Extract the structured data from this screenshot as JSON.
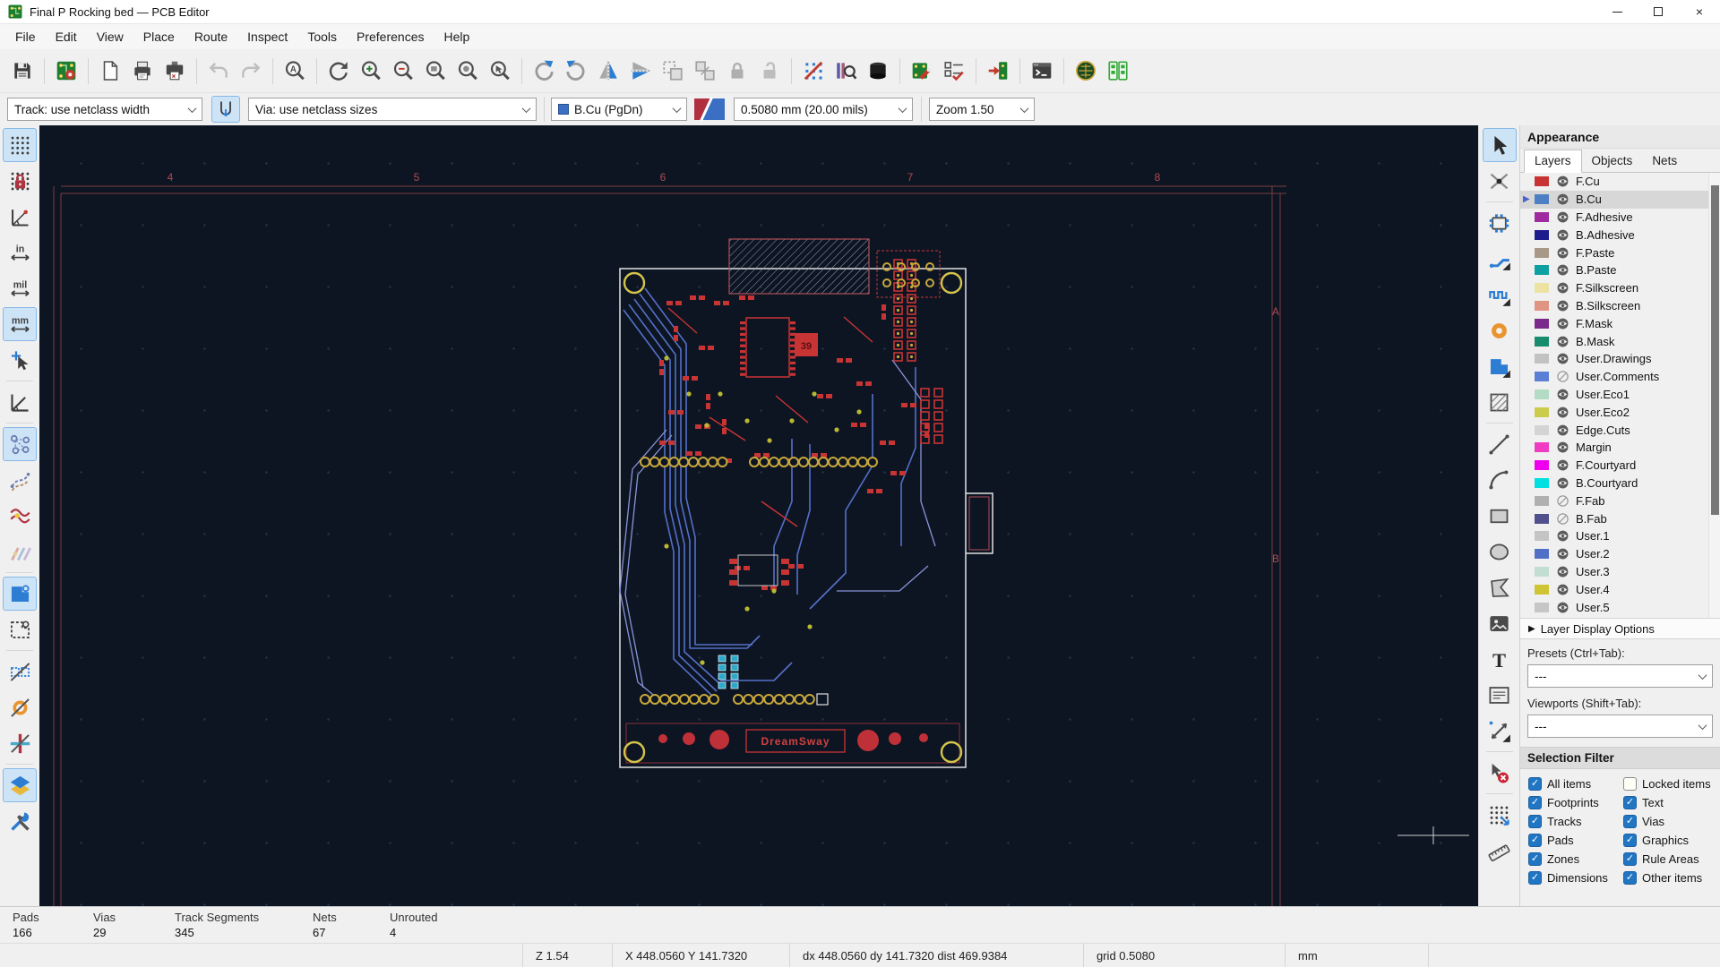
{
  "window": {
    "title": "Final P Rocking bed — PCB Editor"
  },
  "menu": {
    "items": [
      "File",
      "Edit",
      "View",
      "Place",
      "Route",
      "Inspect",
      "Tools",
      "Preferences",
      "Help"
    ]
  },
  "toolbar_top": {
    "buttons": [
      {
        "name": "save-icon"
      },
      {
        "sep": true
      },
      {
        "name": "board-setup-icon"
      },
      {
        "sep": true
      },
      {
        "name": "page-settings-icon"
      },
      {
        "name": "print-icon"
      },
      {
        "name": "plot-icon"
      },
      {
        "sep": true
      },
      {
        "name": "undo-icon",
        "disabled": true
      },
      {
        "name": "redo-icon",
        "disabled": true
      },
      {
        "sep": true
      },
      {
        "name": "find-icon"
      },
      {
        "sep": true
      },
      {
        "name": "refresh-icon"
      },
      {
        "name": "zoom-in-icon"
      },
      {
        "name": "zoom-out-icon"
      },
      {
        "name": "zoom-fit-icon"
      },
      {
        "name": "zoom-objects-icon"
      },
      {
        "name": "zoom-selection-icon"
      },
      {
        "sep": true
      },
      {
        "name": "rotate-ccw-icon"
      },
      {
        "name": "rotate-cw-icon"
      },
      {
        "name": "flip-horizontal-icon"
      },
      {
        "name": "flip-vertical-icon"
      },
      {
        "name": "group-icon",
        "disabled": true
      },
      {
        "name": "ungroup-icon",
        "disabled": true
      },
      {
        "name": "lock-icon",
        "disabled": true
      },
      {
        "name": "unlock-icon",
        "disabled": true
      },
      {
        "sep": true
      },
      {
        "name": "ratsnest-visibility-icon"
      },
      {
        "name": "net-inspector-icon"
      },
      {
        "name": "layer-stack-icon"
      },
      {
        "sep": true
      },
      {
        "name": "footprint-editor-icon"
      },
      {
        "name": "drc-icon"
      },
      {
        "sep": true
      },
      {
        "name": "update-pcb-icon"
      },
      {
        "sep": true
      },
      {
        "name": "scripting-console-icon"
      },
      {
        "sep": true
      },
      {
        "name": "3d-viewer-icon"
      },
      {
        "name": "board-statistics-icon"
      }
    ]
  },
  "toolbar_options": {
    "track_width": "Track: use netclass width",
    "via_size": "Via: use netclass sizes",
    "active_layer": "B.Cu (PgDn)",
    "grid": "0.5080 mm (20.00 mils)",
    "zoom": "Zoom 1.50",
    "layer_color": "#3a6fc4"
  },
  "toolbar_left": {
    "buttons": [
      {
        "name": "grid-visibility-icon",
        "active": true
      },
      {
        "name": "grid-override-icon"
      },
      {
        "name": "polar-coords-icon"
      },
      {
        "name": "units-inches-icon",
        "label": "in"
      },
      {
        "name": "units-mils-icon",
        "label": "mil"
      },
      {
        "name": "units-mm-icon",
        "label": "mm",
        "active": true
      },
      {
        "name": "cursor-shape-icon"
      },
      {
        "sep": true
      },
      {
        "name": "constrain-45-icon"
      },
      {
        "sep": true
      },
      {
        "name": "ratsnest-show-icon",
        "active": true
      },
      {
        "name": "ratsnest-curved-icon"
      },
      {
        "name": "net-highlight-icon"
      },
      {
        "name": "net-colors-icon"
      },
      {
        "sep": true
      },
      {
        "name": "zones-filled-icon",
        "active": true
      },
      {
        "name": "zones-outline-icon"
      },
      {
        "sep": true
      },
      {
        "name": "pads-outline-icon"
      },
      {
        "name": "vias-outline-icon"
      },
      {
        "name": "tracks-outline-icon"
      },
      {
        "sep": true
      },
      {
        "name": "high-contrast-icon",
        "active": true
      },
      {
        "name": "settings-tools-icon"
      }
    ]
  },
  "toolbar_right": {
    "buttons": [
      {
        "name": "select-icon",
        "active": true
      },
      {
        "name": "highlight-net-icon"
      },
      {
        "sep": true
      },
      {
        "name": "footprint-tool-icon"
      },
      {
        "name": "route-track-icon",
        "corner": true
      },
      {
        "name": "tune-length-icon",
        "corner": true
      },
      {
        "name": "via-tool-icon"
      },
      {
        "name": "zone-tool-icon"
      },
      {
        "name": "rule-area-icon"
      },
      {
        "sep": true
      },
      {
        "name": "line-tool-icon"
      },
      {
        "name": "arc-tool-icon"
      },
      {
        "name": "rect-tool-icon"
      },
      {
        "name": "circle-tool-icon"
      },
      {
        "name": "polygon-tool-icon"
      },
      {
        "name": "image-tool-icon"
      },
      {
        "name": "text-tool-icon"
      },
      {
        "name": "textbox-tool-icon"
      },
      {
        "name": "dimension-tool-icon",
        "corner": true
      },
      {
        "sep": true
      },
      {
        "name": "delete-tool-icon"
      },
      {
        "sep": true
      },
      {
        "name": "origin-tool-icon",
        "corner": true
      },
      {
        "name": "measure-tool-icon"
      }
    ]
  },
  "appearance": {
    "title": "Appearance",
    "tabs": [
      {
        "label": "Layers",
        "active": true
      },
      {
        "label": "Objects",
        "active": false
      },
      {
        "label": "Nets",
        "active": false
      }
    ],
    "layers": [
      {
        "name": "F.Cu",
        "color": "#c83434",
        "visible": true
      },
      {
        "name": "B.Cu",
        "color": "#4d7fc4",
        "visible": true,
        "selected": true
      },
      {
        "name": "F.Adhesive",
        "color": "#a02aa0",
        "visible": true
      },
      {
        "name": "B.Adhesive",
        "color": "#1c1c8c",
        "visible": true
      },
      {
        "name": "F.Paste",
        "color": "#a89888",
        "visible": true
      },
      {
        "name": "B.Paste",
        "color": "#0ea0a0",
        "visible": true
      },
      {
        "name": "F.Silkscreen",
        "color": "#ece2a2",
        "visible": true
      },
      {
        "name": "B.Silkscreen",
        "color": "#e09482",
        "visible": true
      },
      {
        "name": "F.Mask",
        "color": "#7a2a8a",
        "visible": true
      },
      {
        "name": "B.Mask",
        "color": "#168c6c",
        "visible": true
      },
      {
        "name": "User.Drawings",
        "color": "#c2c2c2",
        "visible": true
      },
      {
        "name": "User.Comments",
        "color": "#5b7fd4",
        "visible": false
      },
      {
        "name": "User.Eco1",
        "color": "#b2dcc4",
        "visible": true
      },
      {
        "name": "User.Eco2",
        "color": "#cccc4c",
        "visible": true
      },
      {
        "name": "Edge.Cuts",
        "color": "#d4d4d4",
        "visible": true
      },
      {
        "name": "Margin",
        "color": "#ef3cc3",
        "visible": true
      },
      {
        "name": "F.Courtyard",
        "color": "#ee00ee",
        "visible": true
      },
      {
        "name": "B.Courtyard",
        "color": "#00e0e0",
        "visible": true
      },
      {
        "name": "F.Fab",
        "color": "#b0b0b0",
        "visible": false
      },
      {
        "name": "B.Fab",
        "color": "#50508c",
        "visible": false
      },
      {
        "name": "User.1",
        "color": "#c4c4c4",
        "visible": true
      },
      {
        "name": "User.2",
        "color": "#5070c8",
        "visible": true
      },
      {
        "name": "User.3",
        "color": "#c2ded2",
        "visible": true
      },
      {
        "name": "User.4",
        "color": "#cfc433",
        "visible": true
      },
      {
        "name": "User.5",
        "color": "#c6c6c6",
        "visible": true
      }
    ],
    "layer_display_options": "Layer Display Options",
    "presets_label": "Presets (Ctrl+Tab):",
    "presets_value": "---",
    "viewports_label": "Viewports (Shift+Tab):",
    "viewports_value": "---",
    "selection_filter": {
      "title": "Selection Filter",
      "items": [
        {
          "label": "All items",
          "checked": true
        },
        {
          "label": "Locked items",
          "checked": false
        },
        {
          "label": "Footprints",
          "checked": true
        },
        {
          "label": "Text",
          "checked": true
        },
        {
          "label": "Tracks",
          "checked": true
        },
        {
          "label": "Vias",
          "checked": true
        },
        {
          "label": "Pads",
          "checked": true
        },
        {
          "label": "Graphics",
          "checked": true
        },
        {
          "label": "Zones",
          "checked": true
        },
        {
          "label": "Rule Areas",
          "checked": true
        },
        {
          "label": "Dimensions",
          "checked": true
        },
        {
          "label": "Other items",
          "checked": true
        }
      ]
    }
  },
  "canvas": {
    "frame_columns": [
      "4",
      "5",
      "6",
      "7",
      "8"
    ],
    "frame_rows": [
      "A",
      "B"
    ],
    "silkscreen_text": "DreamSway",
    "pad_number": "39",
    "board_edge_color": "#e2e2e2",
    "front_copper_color": "#c83434",
    "back_copper_color": "#5570c8"
  },
  "status": {
    "counts": [
      {
        "label": "Pads",
        "value": "166"
      },
      {
        "label": "Vias",
        "value": "29"
      },
      {
        "label": "Track Segments",
        "value": "345"
      },
      {
        "label": "Nets",
        "value": "67"
      },
      {
        "label": "Unrouted",
        "value": "4"
      }
    ],
    "zoom": "Z 1.54",
    "position": "X 448.0560  Y 141.7320",
    "delta": "dx 448.0560  dy 141.7320  dist 469.9384",
    "grid": "grid 0.5080",
    "units": "mm"
  }
}
